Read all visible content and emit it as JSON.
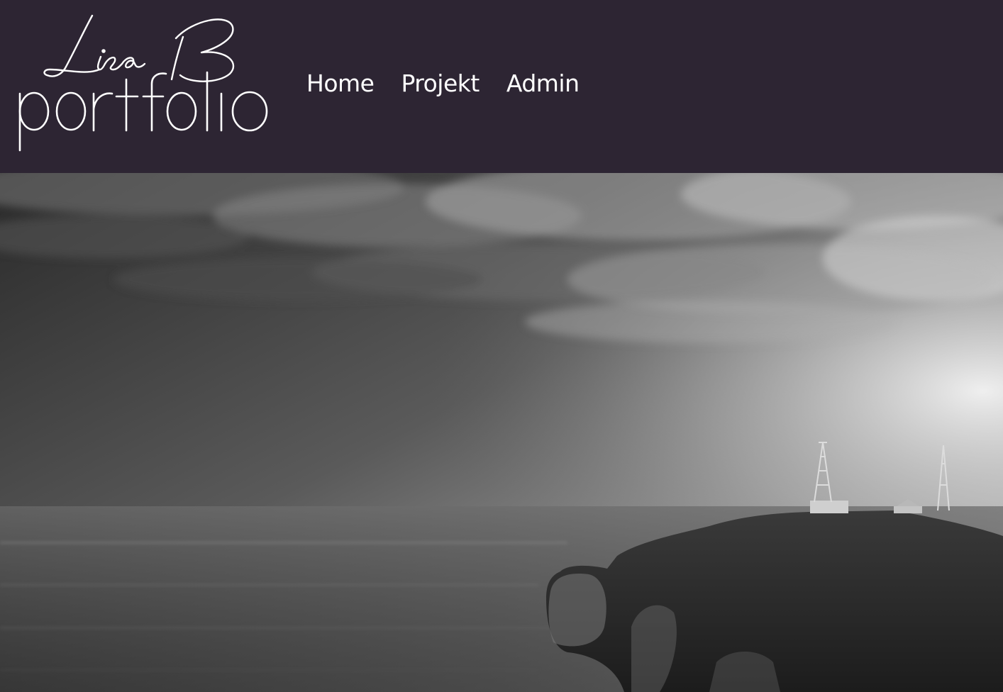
{
  "header": {
    "background_color": "#2d2533",
    "logo": {
      "script_text": "Lisa B",
      "wordmark_text": "portfolio",
      "color": "#ffffff"
    },
    "nav": [
      {
        "label": "Home"
      },
      {
        "label": "Projekt"
      },
      {
        "label": "Admin"
      }
    ]
  },
  "hero": {
    "style": "black-and-white",
    "icon": "coastal-cliff-lighthouse-photo"
  }
}
